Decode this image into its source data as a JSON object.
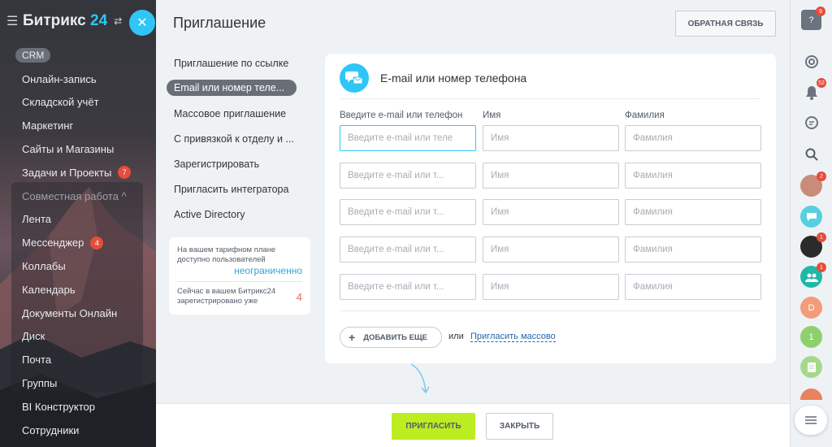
{
  "sidebar": {
    "logo_main": "Битрикс",
    "logo_num": "24",
    "items": [
      {
        "label": "CRM"
      },
      {
        "label": "Онлайн-запись"
      },
      {
        "label": "Складской учёт"
      },
      {
        "label": "Маркетинг"
      },
      {
        "label": "Сайты и Магазины"
      },
      {
        "label": "Задачи и Проекты",
        "badge": "7"
      },
      {
        "label": "Совместная работа ^"
      },
      {
        "label": "Лента"
      },
      {
        "label": "Мессенджер",
        "badge": "4"
      },
      {
        "label": "Коллабы"
      },
      {
        "label": "Календарь"
      },
      {
        "label": "Документы Онлайн"
      },
      {
        "label": "Диск"
      },
      {
        "label": "Почта"
      },
      {
        "label": "Группы"
      },
      {
        "label": "BI Конструктор"
      },
      {
        "label": "Сотрудники"
      }
    ]
  },
  "main": {
    "title": "Приглашение",
    "feedback_label": "ОБРАТНАЯ СВЯЗЬ",
    "menu": [
      "Приглашение по ссылке",
      "Email или номер теле...",
      "Массовое приглашение",
      "С привязкой к отделу и ...",
      "Зарегистрировать",
      "Пригласить интегратора",
      "Active Directory"
    ],
    "info": {
      "plan_text": "На вашем тарифном плане доступно пользователей",
      "plan_value": "неограниченно",
      "registered_text": "Сейчас в вашем Битрикс24 зарегистрировано уже",
      "registered_value": "4"
    },
    "card": {
      "title": "E-mail или номер телефона",
      "col_email": "Введите e-mail или телефон",
      "col_name": "Имя",
      "col_surname": "Фамилия",
      "email_placeholder_first": "Введите e-mail или теле",
      "email_placeholder": "Введите e-mail или т...",
      "name_placeholder": "Имя",
      "surname_placeholder": "Фамилия",
      "add_more_label": "ДОБАВИТЬ ЕЩЕ",
      "or_text": "или",
      "mass_link": "Пригласить массово"
    },
    "footer": {
      "invite_label": "ПРИГЛАСИТЬ",
      "close_label": "ЗАКРЫТЬ"
    }
  },
  "rightbar": {
    "help_badge": "9",
    "bell_badge": "52",
    "avatar1_badge": "2",
    "avatar3_badge": "1",
    "avatar4_badge": "1",
    "avatar_d_letter": "D",
    "avatar_1_letter": "1"
  },
  "colors": {
    "accent": "#2fc6f6",
    "invite_green": "#bbed21",
    "badge_red": "#e74c3c",
    "link_blue": "#2066b0"
  }
}
